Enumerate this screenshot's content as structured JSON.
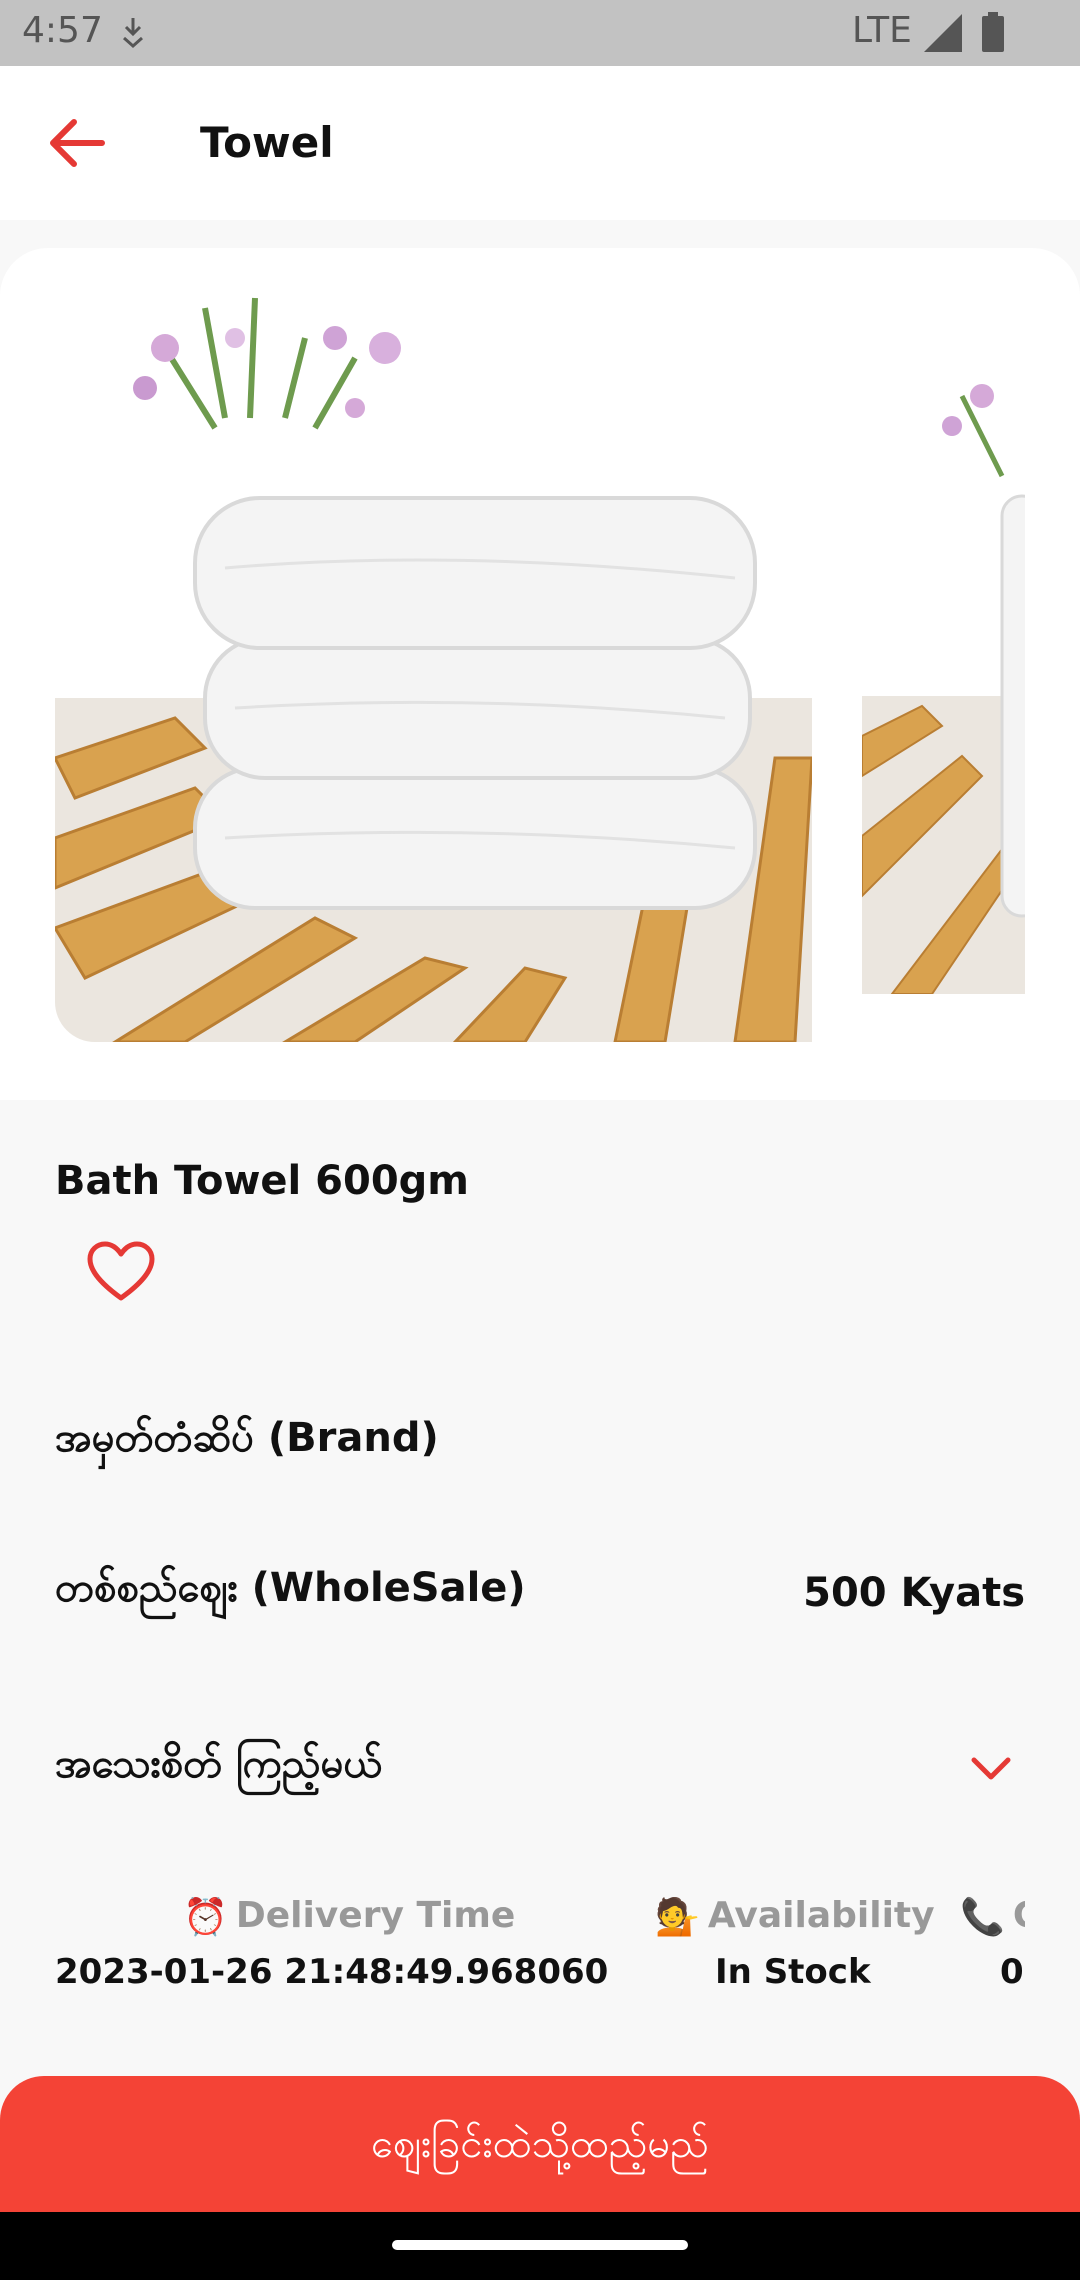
{
  "status_bar": {
    "time": "4:57",
    "network": "LTE"
  },
  "header": {
    "title": "Towel"
  },
  "product": {
    "name": "Bath Towel 600gm",
    "brand_label": "အမှတ်တံဆိပ် (Brand)",
    "wholesale_label": "တစ်စည်ဈေး (WholeSale)",
    "price": "500 Kyats",
    "details_label": "အသေးစိတ် ကြည့်မယ်"
  },
  "info": {
    "delivery_label": "Delivery Time",
    "delivery_value": "2023-01-26 21:48:49.968060",
    "availability_label": "Availability",
    "availability_value": "In Stock",
    "contact_label": "C",
    "contact_value": "0"
  },
  "cart_button": {
    "label": "ဈေးခြင်းထဲသို့ထည့်မည်"
  },
  "colors": {
    "accent": "#f44336",
    "status_bar": "#c2c2c2"
  },
  "icons": [
    "back-arrow-icon",
    "heart-icon",
    "chevron-down-icon",
    "alarm-clock-icon",
    "person-tipping-hand-icon",
    "phone-icon"
  ]
}
